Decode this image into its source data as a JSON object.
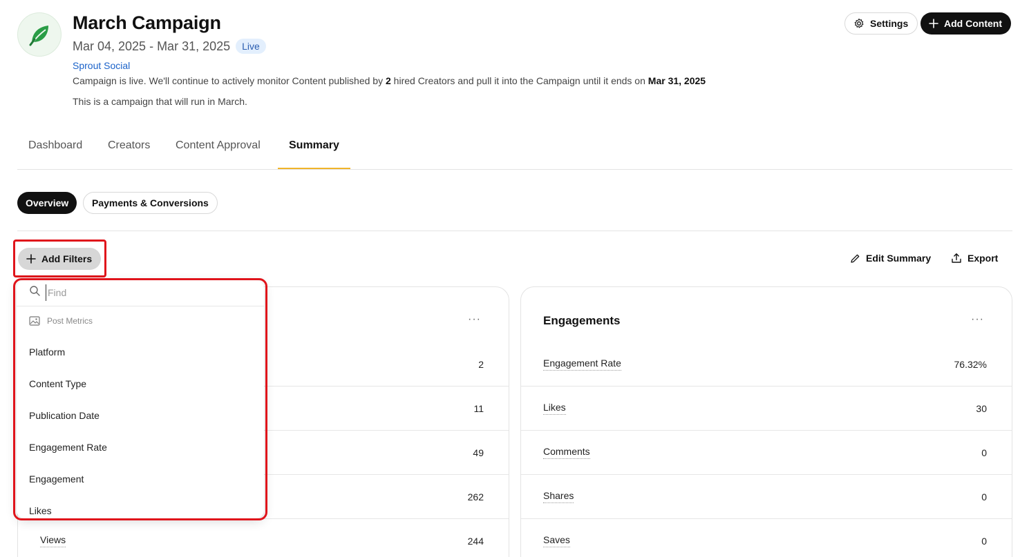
{
  "header": {
    "title": "March Campaign",
    "dates": "Mar 04, 2025 - Mar 31, 2025",
    "status_badge": "Live",
    "brand": "Sprout Social",
    "status_prefix": "Campaign is live. We'll continue to actively monitor Content published by ",
    "creator_count": "2",
    "status_middle": " hired Creators and pull it into the Campaign until it ends on ",
    "end_date": "Mar 31, 2025",
    "description": "This is a campaign that will run in March.",
    "settings_label": "Settings",
    "add_content_label": "Add Content"
  },
  "tabs": [
    {
      "label": "Dashboard"
    },
    {
      "label": "Creators"
    },
    {
      "label": "Content Approval"
    },
    {
      "label": "Summary",
      "active": true
    }
  ],
  "subtabs": {
    "overview": "Overview",
    "payments": "Payments & Conversions"
  },
  "toolbar": {
    "add_filters": "Add Filters",
    "edit_summary": "Edit Summary",
    "export": "Export"
  },
  "filter_dropdown": {
    "search_placeholder": "Find",
    "section": "Post Metrics",
    "options": [
      "Platform",
      "Content Type",
      "Publication Date",
      "Engagement Rate",
      "Engagement",
      "Likes"
    ]
  },
  "left_card": {
    "menu": "···",
    "rows": [
      {
        "label": "",
        "value": "2"
      },
      {
        "label": "",
        "value": "11"
      },
      {
        "label": "",
        "value": "49"
      },
      {
        "label": "",
        "value": "262"
      },
      {
        "label": "Views",
        "value": "244"
      }
    ]
  },
  "right_card": {
    "title": "Engagements",
    "menu": "···",
    "rows": [
      {
        "label": "Engagement Rate",
        "value": "76.32%"
      },
      {
        "label": "Likes",
        "value": "30"
      },
      {
        "label": "Comments",
        "value": "0"
      },
      {
        "label": "Shares",
        "value": "0"
      },
      {
        "label": "Saves",
        "value": "0"
      }
    ]
  },
  "colors": {
    "accent_tab": "#f0b429",
    "highlight": "#e0141b",
    "brand_link": "#1a62c9",
    "logo_green": "#2a9d46"
  }
}
